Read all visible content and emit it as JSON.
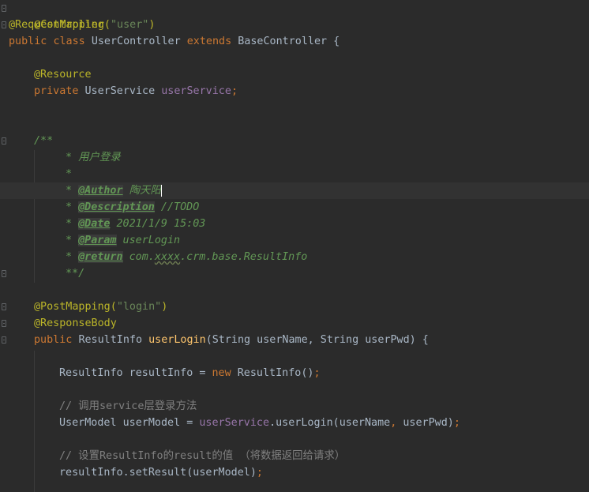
{
  "code": {
    "l1": "@Controller",
    "l2_ann": "@RequestMapping(",
    "l2_str": "\"user\"",
    "l2_end": ")",
    "l3_public": "public ",
    "l3_class": "class ",
    "l3_name": "UserController ",
    "l3_extends": "extends ",
    "l3_base": "BaseController {",
    "l4": "@Resource",
    "l5_private": "private ",
    "l5_type": "UserService ",
    "l5_field": "userService",
    "l5_semi": ";",
    "l6": "/**",
    "l7": "* 用户登录",
    "l8": "*",
    "l9_star": "* ",
    "l9_tag": "@Author",
    "l9_text": " 陶天阳",
    "l10_star": "* ",
    "l10_tag": "@Description",
    "l10_text": " //TODO",
    "l11_star": "* ",
    "l11_tag": "@Date",
    "l11_text": " 2021/1/9 15:03",
    "l12_star": "* ",
    "l12_tag": "@Param",
    "l12_text": " userLogin",
    "l13_star": "* ",
    "l13_tag": "@return",
    "l13_pre": " com.",
    "l13_typo": "xxxx",
    "l13_post": ".crm.base.ResultInfo",
    "l14": "**/",
    "l15_ann": "@PostMapping(",
    "l15_str": "\"login\"",
    "l15_end": ")",
    "l16": "@ResponseBody",
    "l17_public": "public ",
    "l17_type": "ResultInfo ",
    "l17_method": "userLogin",
    "l17_params": "(String userName, String userPwd) {",
    "l18_pre": "ResultInfo resultInfo = ",
    "l18_new": "new ",
    "l18_post": "ResultInfo()",
    "l18_semi": ";",
    "l19": "// 调用service层登录方法",
    "l20_pre": "UserModel userModel = ",
    "l20_field": "userService",
    "l20_call": ".userLogin(userName",
    "l20_comma": ", ",
    "l20_arg": "userPwd)",
    "l20_semi": ";",
    "l21": "// 设置ResultInfo的result的值 （将数据返回给请求）",
    "l22_call": "resultInfo.setResult(userModel)",
    "l22_semi": ";"
  },
  "colors": {
    "background": "#2b2b2b",
    "annotation": "#bbb529",
    "keyword": "#cc7832",
    "string": "#6a8759",
    "field": "#9876aa",
    "method": "#ffc66d",
    "doc_comment": "#629755",
    "line_comment": "#808080",
    "default_text": "#a9b7c6"
  },
  "icons": {
    "intention": "lightbulb-icon",
    "fold": "fold-marker-icon"
  }
}
